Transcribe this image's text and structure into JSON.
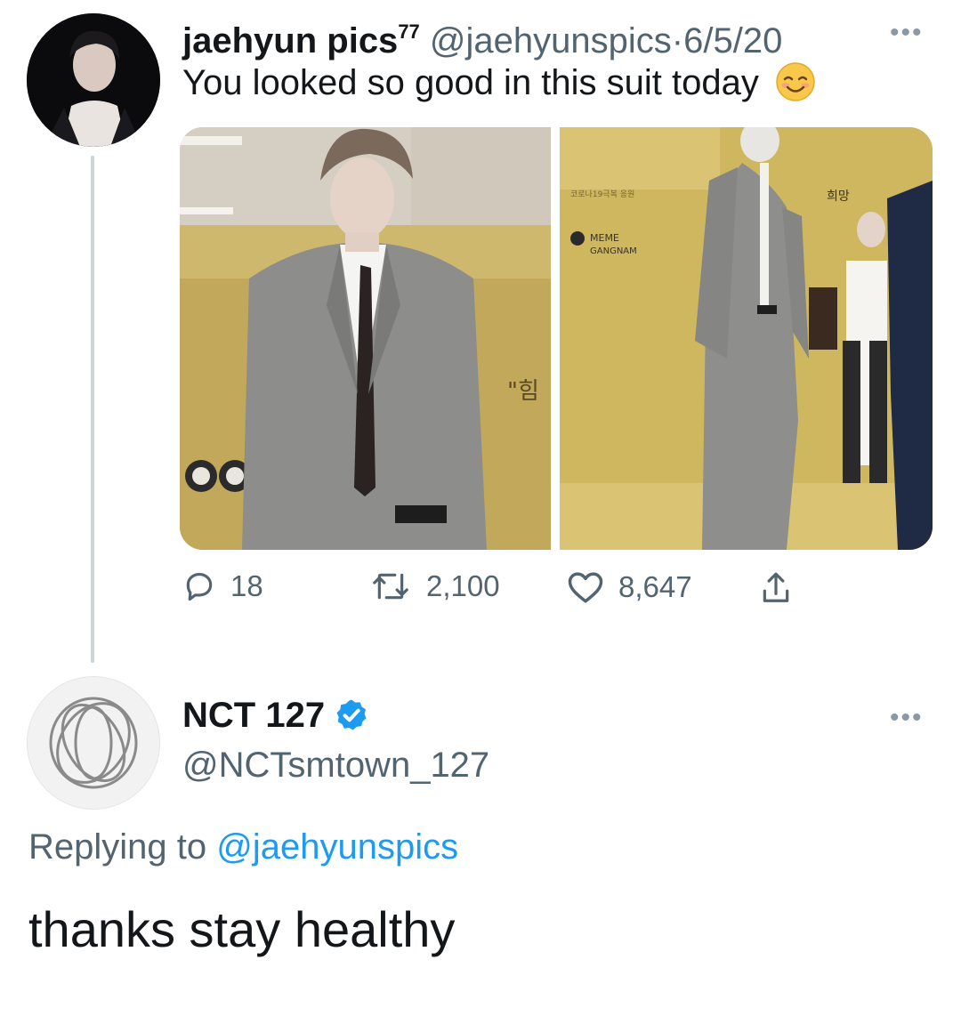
{
  "tweet_original": {
    "display_name": "jaehyun pics",
    "name_suffix": "77",
    "handle": "@jaehyunspics",
    "separator": "·",
    "date": "6/5/20",
    "more_icon": "ellipsis-icon",
    "text": "You looked so good in this suit today",
    "emoji": "smiling-face-with-smiling-eyes",
    "media_signage": {
      "left_sign": "\"힘",
      "right_logo_line1": "MEME",
      "right_logo_line2": "GANGNAM",
      "right_top_sign": "희망",
      "right_top_small": "코로나19극복 응원"
    },
    "actions": {
      "reply_count": "18",
      "retweet_count": "2,100",
      "like_count": "8,647",
      "share_icon": "share-icon"
    }
  },
  "tweet_reply": {
    "display_name": "NCT 127",
    "verified_icon": "verified-badge-icon",
    "handle": "@NCTsmtown_127",
    "more_icon": "ellipsis-icon",
    "replying_label": "Replying to",
    "replying_to": "@jaehyunspics",
    "text": "thanks stay healthy"
  },
  "colors": {
    "text_primary": "#14171a",
    "text_secondary": "#536471",
    "link_blue": "#1d9bf0",
    "verified_blue": "#1d9bf0",
    "thread_line": "#cfd4d8"
  }
}
